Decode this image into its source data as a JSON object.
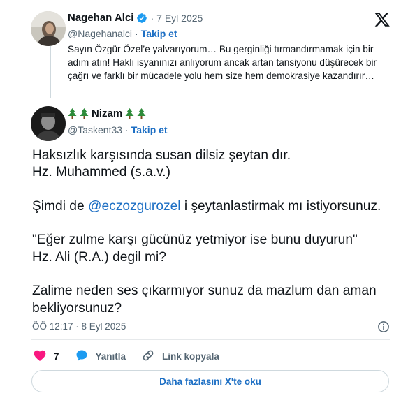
{
  "quoted": {
    "display_name": "Nagehan Alci",
    "handle": "@Nagehanalci",
    "date": "7 Eyl 2025",
    "follow_label": "Takip et",
    "separator": "·",
    "text": "Sayın Özgür Özel’e yalvarıyorum… Bu gerginliği tırmandırmamak için bir adım atın! Haklı isyanınızı anlıyorum ancak artan tansiyonu düşürecek bir çağrı ve farklı bir mücadele yolu hem size hem demokrasiye kazandırır…",
    "verified_icon": "verified-badge-icon"
  },
  "tweet": {
    "display_name": "Nizam",
    "name_emoji": "evergreen-tree-icon",
    "handle": "@Taskent33",
    "follow_label": "Takip et",
    "separator": "·",
    "paragraphs": [
      "Haksızlık karşısında susan dilsiz şeytan dır.\nHz. Muhammed (s.a.v.)",
      "Şimdi de ",
      "\"Eğer zulme karşı gücünüz yetmiyor ise bunu duyurun\"\nHz. Ali (R.A.)  degil mi?",
      "Zalime neden ses çıkarmıyor sunuz da mazlum dan aman bekliyorsunuz?"
    ],
    "mention": "@eczozgurozel",
    "mention_suffix": " i şeytanlastirmak mı istiyorsunuz.",
    "timestamp": "ÖÖ 12:17 · 8 Eyl 2025"
  },
  "actions": {
    "like_count": "7",
    "reply_label": "Yanıtla",
    "copy_link_label": "Link kopyala",
    "read_more_label": "Daha fazlasını X'te oku"
  },
  "colors": {
    "accent": "#1d6fc4",
    "like": "#f91880",
    "muted": "#536471",
    "verified": "#1d9bf0"
  }
}
